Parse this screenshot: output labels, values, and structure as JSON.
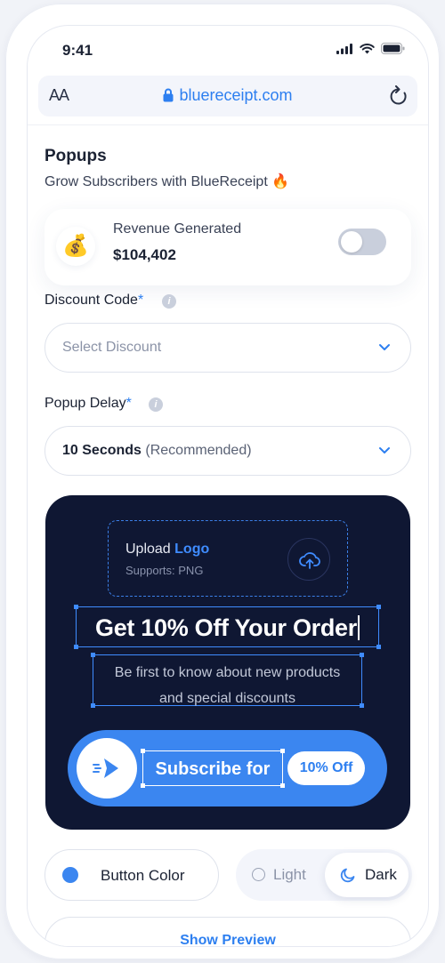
{
  "status_bar": {
    "time": "9:41"
  },
  "browser": {
    "text_size_label": "AA",
    "url": "bluereceipt.com"
  },
  "page": {
    "title": "Popups",
    "subtitle": "Grow Subscribers with BlueReceipt 🔥"
  },
  "revenue": {
    "icon": "money-bag-icon",
    "emoji": "💰",
    "label": "Revenue Generated",
    "value": "$104,402",
    "toggle_on": false
  },
  "discount": {
    "label": "Discount Code",
    "required_mark": "*",
    "placeholder": "Select Discount"
  },
  "delay": {
    "label": "Popup Delay",
    "required_mark": "*",
    "value": "10 Seconds",
    "hint": "(Recommended)"
  },
  "popup_preview": {
    "upload_prefix": "Upload",
    "upload_highlight": "Logo",
    "upload_sub": "Supports: PNG",
    "headline": "Get 10% Off Your Order",
    "description_line1": "Be first to know about new products",
    "description_line2": "and special discounts",
    "cta_text": "Subscribe for",
    "cta_badge": "10% Off",
    "background_color": "#0f1733",
    "accent_color": "#3b86f0"
  },
  "controls": {
    "button_color_label": "Button Color",
    "button_color_value": "#3b86f0",
    "theme_light": "Light",
    "theme_dark": "Dark",
    "theme_selected": "Dark",
    "show_preview": "Show Preview"
  }
}
